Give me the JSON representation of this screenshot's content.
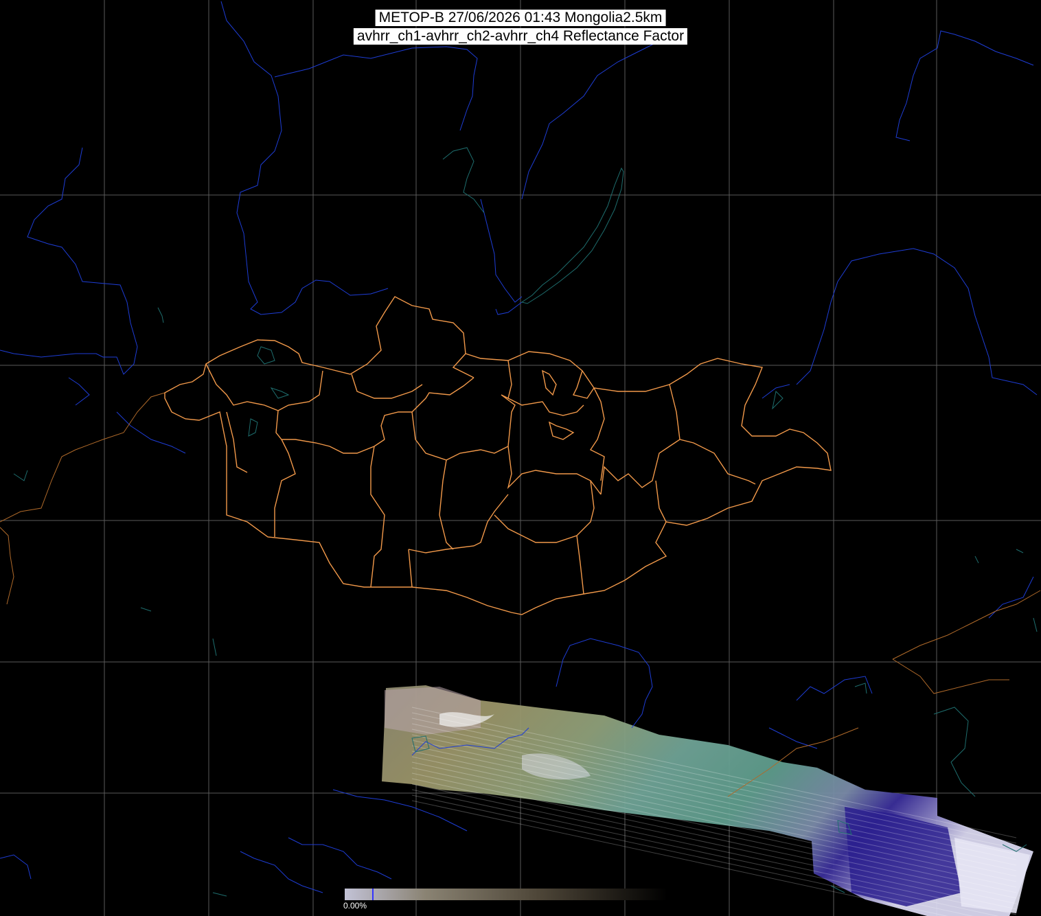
{
  "title": {
    "line1": "METOP-B 27/06/2026 01:43 Mongolia2.5km",
    "line2": "avhrr_ch1-avhrr_ch2-avhrr_ch4 Reflectance Factor"
  },
  "colorbar": {
    "label": "0.00%",
    "stops": [
      "#c2c2d6",
      "#8a8373",
      "#5a5244",
      "#000000"
    ],
    "marker_color": "#3333ff"
  },
  "layers": {
    "graticule_color": "#5a5a5a",
    "river_color": "#1e3dd6",
    "lake_color": "#1e6e6e",
    "mongolia_border_color": "#f2994a",
    "other_border_color": "#b06a2a"
  },
  "swath": {
    "description_colors": [
      "#8f8a62",
      "#6fa396",
      "#b8b4d8",
      "#3a2e9a",
      "#d8d6ee"
    ]
  }
}
